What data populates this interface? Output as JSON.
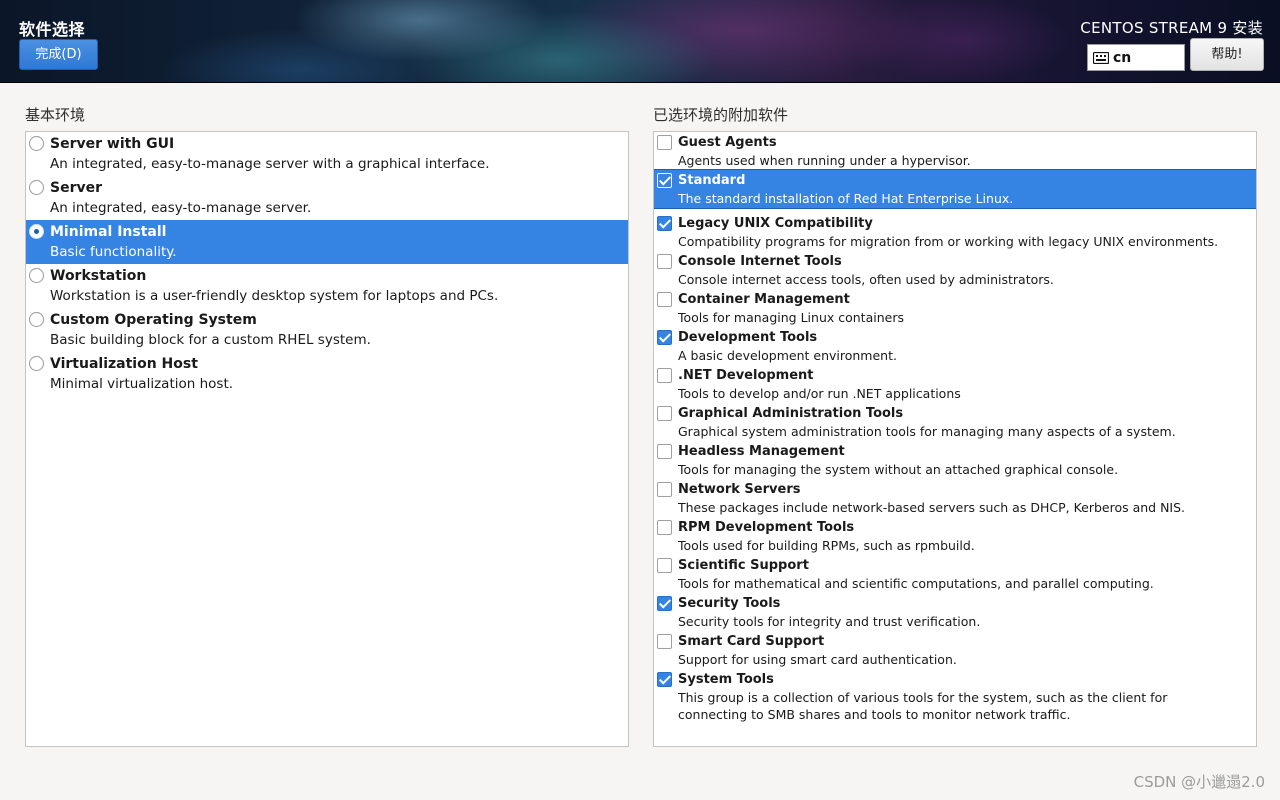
{
  "header": {
    "title": "软件选择",
    "done_label": "完成(D)",
    "product_title": "CENTOS STREAM 9 安装",
    "keyboard_layout": "cn",
    "help_label": "帮助!"
  },
  "left": {
    "section_label": "基本环境",
    "environments": [
      {
        "name": "Server with GUI",
        "desc": "An integrated, easy-to-manage server with a graphical interface.",
        "selected": false
      },
      {
        "name": "Server",
        "desc": "An integrated, easy-to-manage server.",
        "selected": false
      },
      {
        "name": "Minimal Install",
        "desc": "Basic functionality.",
        "selected": true
      },
      {
        "name": "Workstation",
        "desc": "Workstation is a user-friendly desktop system for laptops and PCs.",
        "selected": false
      },
      {
        "name": "Custom Operating System",
        "desc": "Basic building block for a custom RHEL system.",
        "selected": false
      },
      {
        "name": "Virtualization Host",
        "desc": "Minimal virtualization host.",
        "selected": false
      }
    ]
  },
  "right": {
    "section_label": "已选环境的附加软件",
    "addons": [
      {
        "name": "Guest Agents",
        "desc": "Agents used when running under a hypervisor.",
        "checked": false,
        "highlighted": false
      },
      {
        "name": "Standard",
        "desc": "The standard installation of Red Hat Enterprise Linux.",
        "checked": true,
        "highlighted": true
      },
      {
        "name": "Legacy UNIX Compatibility",
        "desc": "Compatibility programs for migration from or working with legacy UNIX environments.",
        "checked": true,
        "highlighted": false
      },
      {
        "name": "Console Internet Tools",
        "desc": "Console internet access tools, often used by administrators.",
        "checked": false,
        "highlighted": false
      },
      {
        "name": "Container Management",
        "desc": "Tools for managing Linux containers",
        "checked": false,
        "highlighted": false
      },
      {
        "name": "Development Tools",
        "desc": "A basic development environment.",
        "checked": true,
        "highlighted": false
      },
      {
        "name": ".NET Development",
        "desc": "Tools to develop and/or run .NET applications",
        "checked": false,
        "highlighted": false
      },
      {
        "name": "Graphical Administration Tools",
        "desc": "Graphical system administration tools for managing many aspects of a system.",
        "checked": false,
        "highlighted": false
      },
      {
        "name": "Headless Management",
        "desc": "Tools for managing the system without an attached graphical console.",
        "checked": false,
        "highlighted": false
      },
      {
        "name": "Network Servers",
        "desc": "These packages include network-based servers such as DHCP, Kerberos and NIS.",
        "checked": false,
        "highlighted": false
      },
      {
        "name": "RPM Development Tools",
        "desc": "Tools used for building RPMs, such as rpmbuild.",
        "checked": false,
        "highlighted": false
      },
      {
        "name": "Scientific Support",
        "desc": "Tools for mathematical and scientific computations, and parallel computing.",
        "checked": false,
        "highlighted": false
      },
      {
        "name": "Security Tools",
        "desc": "Security tools for integrity and trust verification.",
        "checked": true,
        "highlighted": false
      },
      {
        "name": "Smart Card Support",
        "desc": "Support for using smart card authentication.",
        "checked": false,
        "highlighted": false
      },
      {
        "name": "System Tools",
        "desc": "This group is a collection of various tools for the system, such as the client for connecting to SMB shares and tools to monitor network traffic.",
        "checked": true,
        "highlighted": false
      }
    ]
  },
  "watermark": "CSDN @小邋遢2.0",
  "colors": {
    "accent": "#3584e4",
    "done_button": "#2f78d4"
  }
}
